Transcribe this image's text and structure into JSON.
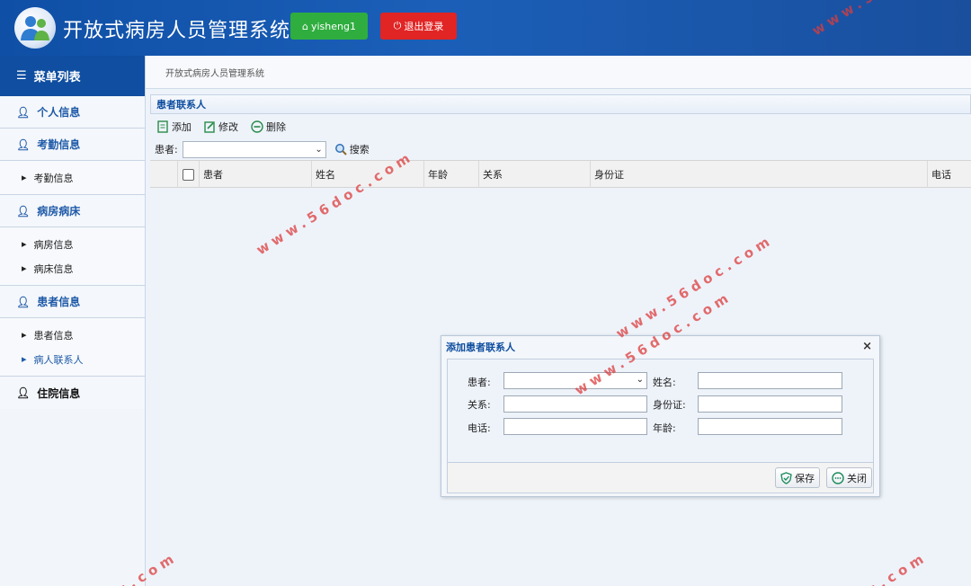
{
  "app": {
    "title": "开放式病房人员管理系统",
    "user_button": "yisheng1",
    "logout_button": "退出登录"
  },
  "sidebar": {
    "header": "菜单列表",
    "sections": [
      {
        "label": "个人信息",
        "items": []
      },
      {
        "label": "考勤信息",
        "items": [
          "考勤信息"
        ]
      },
      {
        "label": "病房病床",
        "items": [
          "病房信息",
          "病床信息"
        ]
      },
      {
        "label": "患者信息",
        "items": [
          "患者信息",
          "病人联系人"
        ]
      },
      {
        "label": "住院信息",
        "items": []
      }
    ]
  },
  "breadcrumb": "开放式病房人员管理系统",
  "panel": {
    "title": "患者联系人",
    "toolbar": {
      "add": "添加",
      "edit": "修改",
      "delete": "删除"
    },
    "search": {
      "label": "患者:",
      "value": "",
      "button": "搜索"
    },
    "columns": [
      "患者",
      "姓名",
      "年龄",
      "关系",
      "身份证",
      "电话"
    ]
  },
  "dialog": {
    "title": "添加患者联系人",
    "close": "×",
    "fields": {
      "patient": {
        "label": "患者:",
        "value": ""
      },
      "name": {
        "label": "姓名:",
        "value": ""
      },
      "relation": {
        "label": "关系:",
        "value": ""
      },
      "idcard": {
        "label": "身份证:",
        "value": ""
      },
      "phone": {
        "label": "电话:",
        "value": ""
      },
      "age": {
        "label": "年龄:",
        "value": ""
      }
    },
    "save": "保存",
    "close_button": "关闭"
  },
  "watermark": "www.56doc.com",
  "watermarks": {
    "w1": "www.56doc.com",
    "w2": "www.56doc.com",
    "w3": "www.56doc.com",
    "w4": "www.56doc.com",
    "w5": "c.com",
    "w6": "c.com"
  },
  "colors": {
    "header": "#1b5fb8",
    "accent": "#0f4ea0",
    "user_button": "#2fae3f",
    "logout_button": "#e12424"
  }
}
